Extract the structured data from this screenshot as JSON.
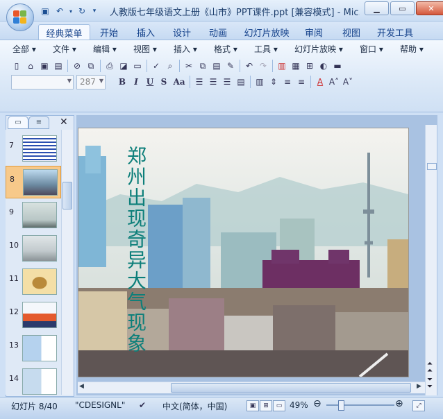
{
  "window": {
    "title": "人教版七年级语文上册《山市》PPT课件.ppt [兼容模式] - Mic...",
    "controls": [
      "minimize-icon",
      "restore-icon",
      "close-icon"
    ]
  },
  "quick_access": [
    "save-icon",
    "undo-icon",
    "redo-icon",
    "customize-icon"
  ],
  "tabs": [
    "经典菜单",
    "开始",
    "插入",
    "设计",
    "动画",
    "幻灯片放映",
    "审阅",
    "视图",
    "开发工具"
  ],
  "menus": [
    "全部",
    "文件",
    "编辑",
    "视图",
    "插入",
    "格式",
    "工具",
    "幻灯片放映",
    "窗口",
    "帮助"
  ],
  "font": {
    "name": "",
    "size": "287"
  },
  "format_buttons": [
    "B",
    "I",
    "U",
    "S",
    "Aa"
  ],
  "slide_pane": {
    "slides": [
      {
        "num": "7"
      },
      {
        "num": "8"
      },
      {
        "num": "9"
      },
      {
        "num": "10"
      },
      {
        "num": "11"
      },
      {
        "num": "12"
      },
      {
        "num": "13"
      },
      {
        "num": "14"
      }
    ],
    "selected": "8"
  },
  "slide": {
    "title": "郑州出现奇异大气现象"
  },
  "status": {
    "slide_info": "幻灯片 8/40",
    "theme": "\"CDESIGNL\"",
    "language": "中文(简体，中国)",
    "zoom": "49%"
  },
  "colors": {
    "accent": "#15428b",
    "selected_thumb": "#f7c98a",
    "slide_title": "#0d7f7a"
  }
}
